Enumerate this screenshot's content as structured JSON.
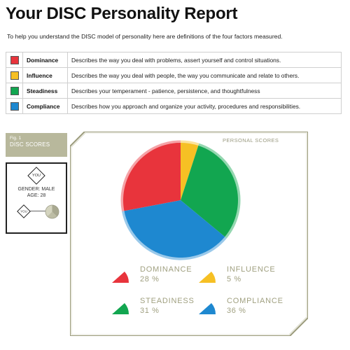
{
  "title": "Your DISC Personality Report",
  "intro": "To help you understand the DISC model of personality here are definitions of the four factors measured.",
  "factors": [
    {
      "name": "Dominance",
      "color": "#e8343c",
      "description": "Describes the way you deal with problems, assert yourself and control situations."
    },
    {
      "name": "Influence",
      "color": "#f6c024",
      "description": "Describes the way you deal with people, the way you communicate and relate to others."
    },
    {
      "name": "Steadiness",
      "color": "#12a650",
      "description": "Describes your temperament - patience, persistence, and thoughtfulness"
    },
    {
      "name": "Compliance",
      "color": "#1e88d0",
      "description": "Describes how you approach and organize your activity, procedures and responsibilities."
    }
  ],
  "figure": {
    "number": "Fig. 1",
    "title": "DISC SCORES"
  },
  "profile": {
    "you": "YOU",
    "gender": "GENDER: MALE",
    "age": "AGE: 28"
  },
  "personal_scores_label": "PERSONAL SCORES",
  "legend": [
    {
      "name": "DOMINANCE",
      "value": "28 %"
    },
    {
      "name": "INFLUENCE",
      "value": "5 %"
    },
    {
      "name": "STEADINESS",
      "value": "31 %"
    },
    {
      "name": "COMPLIANCE",
      "value": "36 %"
    }
  ],
  "chart_data": {
    "type": "pie",
    "title": "PERSONAL SCORES",
    "categories": [
      "DOMINANCE",
      "INFLUENCE",
      "STEADINESS",
      "COMPLIANCE"
    ],
    "values": [
      28,
      5,
      31,
      36
    ],
    "colors": [
      "#e8343c",
      "#f6c024",
      "#12a650",
      "#1e88d0"
    ],
    "unit": "%",
    "legend_position": "bottom"
  }
}
